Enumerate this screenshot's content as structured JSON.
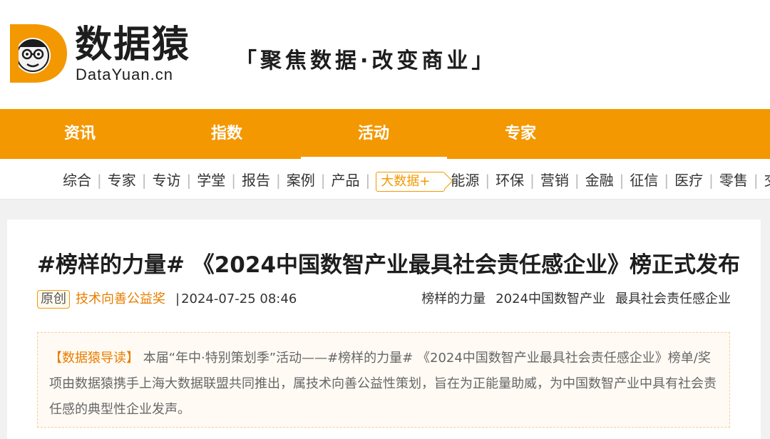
{
  "header": {
    "logo_name": "数据猿",
    "logo_domain": "DataYuan.cn",
    "slogan": "「聚焦数据·改变商业」"
  },
  "mainnav": [
    "资讯",
    "指数",
    "活动",
    "专家"
  ],
  "mainnav_active": "活动",
  "subnav": {
    "before_tag": [
      "综合",
      "专家",
      "专访",
      "学堂",
      "报告",
      "案例",
      "产品"
    ],
    "tag": "大数据+",
    "after_tag": [
      "能源",
      "环保",
      "营销",
      "金融",
      "征信",
      "医疗",
      "零售",
      "交"
    ]
  },
  "article": {
    "title": "#榜样的力量# 《2024中国数智产业最具社会责任感企业》榜正式发布",
    "badge": "原创",
    "category": "技术向善公益奖",
    "divider": "|",
    "date": "2024-07-25 08:46",
    "tags": [
      "榜样的力量",
      "2024中国数智产业",
      "最具社会责任感企业"
    ],
    "summary_lead": "【数据猿导读】",
    "summary_text": "本届“年中·特别策划季”活动——#榜样的力量# 《2024中国数智产业最具社会责任感企业》榜单/奖项由数据猿携手上海大数据联盟共同推出，属技术向善公益性策划，旨在为正能量助威，为中国数智产业中具有社会责任感的典型性企业发声。"
  },
  "colors": {
    "brand_orange": "#f39800",
    "link_orange": "#e87e00"
  }
}
